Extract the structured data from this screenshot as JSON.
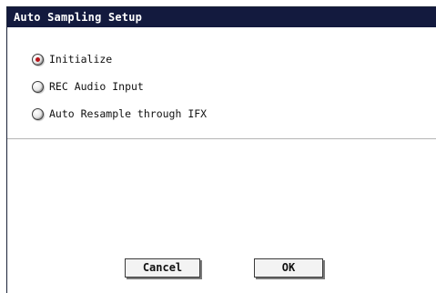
{
  "dialog": {
    "title": "Auto Sampling Setup",
    "options": [
      {
        "label": "Initialize",
        "selected": true
      },
      {
        "label": "REC Audio Input",
        "selected": false
      },
      {
        "label": "Auto Resample through IFX",
        "selected": false
      }
    ],
    "buttons": {
      "cancel_label": "Cancel",
      "ok_label": "OK"
    }
  },
  "colors": {
    "titlebar": "#131a3e",
    "radio_selected_dot": "#b8151b"
  }
}
